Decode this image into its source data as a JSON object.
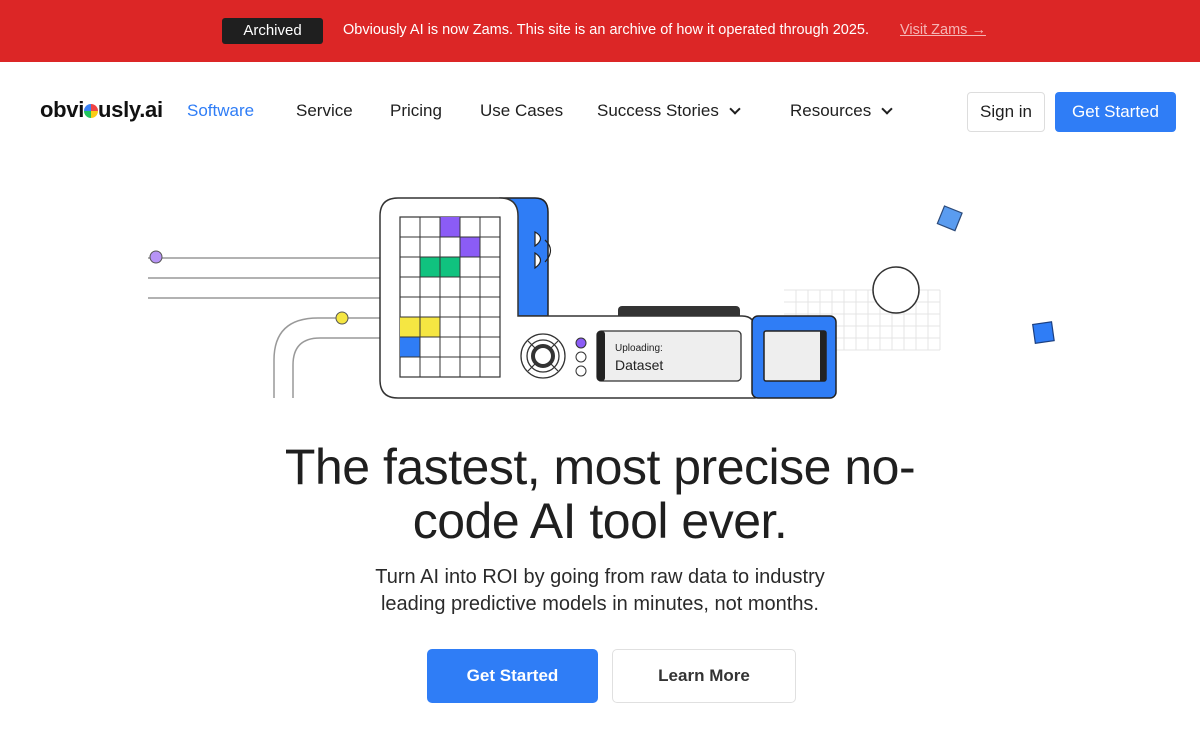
{
  "banner": {
    "badge": "Archived",
    "message": "Obviously AI is now Zams. This site is an archive of how it operated through 2025.",
    "link": "Visit Zams →"
  },
  "brand": {
    "logo_text_before": "obvi",
    "logo_text_after": "usly.ai"
  },
  "nav": {
    "items": [
      {
        "label": "Software",
        "active": true
      },
      {
        "label": "Service"
      },
      {
        "label": "Pricing"
      },
      {
        "label": "Use Cases"
      },
      {
        "label": "Success Stories",
        "dropdown": true
      },
      {
        "label": "Resources",
        "dropdown": true
      }
    ],
    "sign_in": "Sign in",
    "get_started": "Get Started"
  },
  "illustration": {
    "status_label": "Uploading:",
    "status_value": "Dataset"
  },
  "hero": {
    "headline_line1": "The fastest, most precise no-",
    "headline_line2": "code AI tool ever.",
    "subhead_line1": "Turn AI into ROI by going from raw data to industry",
    "subhead_line2": "leading predictive models in minutes, not months.",
    "primary_cta": "Get Started",
    "secondary_cta": "Learn More"
  },
  "colors": {
    "banner_red": "#dc2626",
    "brand_blue": "#2f7df6",
    "purple": "#8b5cf6",
    "green": "#10c27f",
    "yellow": "#f5e642"
  }
}
